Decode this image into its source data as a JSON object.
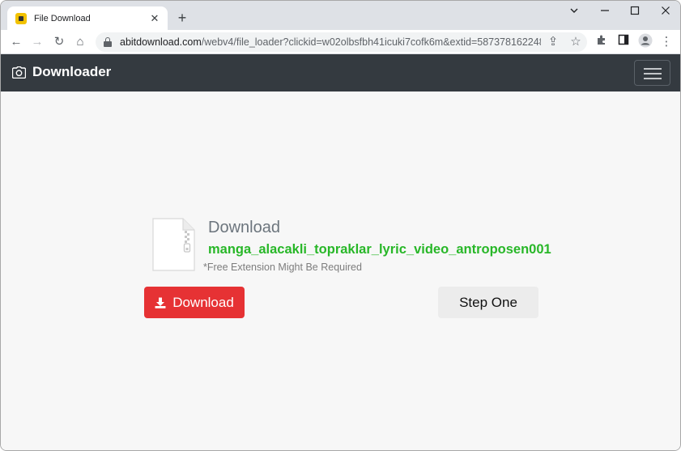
{
  "browser": {
    "tab": {
      "title": "File Download",
      "close": "✕"
    },
    "new_tab": "+",
    "window_controls": {
      "minimize": "—",
      "maximize": "☐",
      "close": "✕",
      "tab_list": "⌄"
    },
    "address": {
      "domain": "abitdownload.com",
      "path": "/webv4/file_loader?clickid=w02olbsfbh41icuki7cofk6m&extid=5873781622485729..."
    },
    "nav": {
      "back": "←",
      "forward": "→",
      "reload": "↻",
      "home": "⌂"
    },
    "toolbar_icons": {
      "share": "⇪",
      "bookmark": "☆",
      "extensions": "✚",
      "side_panel": "▮",
      "profile": "●",
      "menu": "⋮"
    }
  },
  "navbar": {
    "brand": "Downloader",
    "brand_icon": "camera-icon"
  },
  "main": {
    "heading": "Download",
    "filename": "manga_alacakli_topraklar_lyric_video_antroposen001",
    "note": "*Free Extension Might Be Required",
    "download_button": "Download",
    "step_button": "Step One"
  },
  "colors": {
    "navbar_bg": "#343a40",
    "filename": "#28b728",
    "download_button": "#e63234",
    "step_button": "#ececec"
  }
}
